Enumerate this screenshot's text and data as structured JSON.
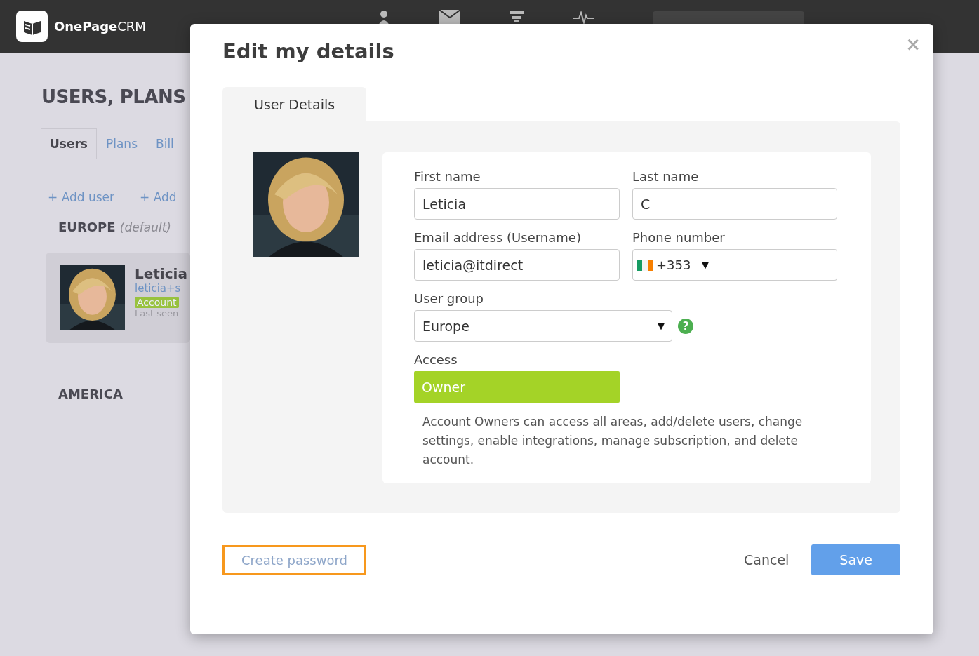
{
  "header": {
    "logo_text": "OnePage",
    "logo_suffix": "CRM"
  },
  "page": {
    "title": "USERS, PLANS",
    "tabs": [
      {
        "label": "Users",
        "selected": true
      },
      {
        "label": "Plans",
        "selected": false
      },
      {
        "label": "Bill",
        "selected": false
      }
    ],
    "links": [
      "+ Add user",
      "+ Add"
    ],
    "groups": [
      {
        "name": "EUROPE",
        "note": "(default)",
        "users": [
          {
            "name": "Leticia",
            "email": "leticia+s",
            "badge": "Account",
            "last_seen": "Last seen"
          }
        ]
      },
      {
        "name": "AMERICA"
      }
    ]
  },
  "dialog": {
    "title": "Edit my details",
    "close": "×",
    "tabs": [
      {
        "label": "User Details",
        "selected": true
      }
    ],
    "fields": [
      {
        "label": "First name",
        "value": "Leticia"
      },
      {
        "label": "Last name",
        "value": "C"
      },
      {
        "label": "Email address (Username)",
        "value": "leticia@itdirect"
      }
    ],
    "phone": {
      "label": "Phone number",
      "code": "+353",
      "arrow": "▼"
    },
    "user_group": {
      "label": "User group",
      "value": "Europe",
      "arrow": "▼",
      "help": "?"
    },
    "access": {
      "label": "Access",
      "value": "Owner",
      "description": "Account Owners can access all areas, add/delete users, change settings, enable integrations, manage subscription, and delete account."
    },
    "create_password": "Create password",
    "cancel": "Cancel",
    "save": "Save"
  }
}
